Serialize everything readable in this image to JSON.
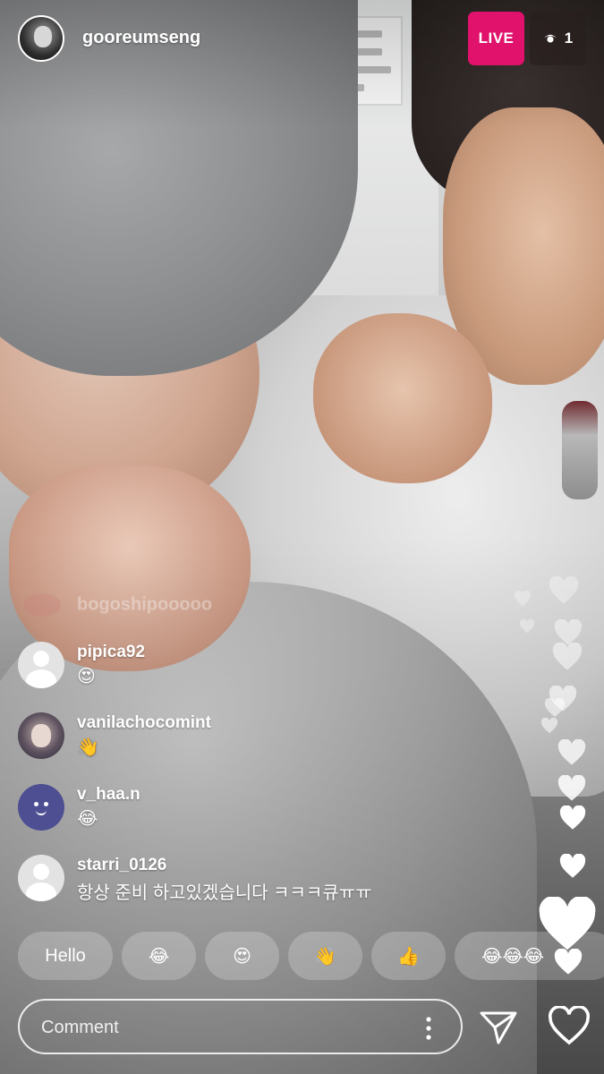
{
  "header": {
    "username": "gooreumseng",
    "live_label": "LIVE",
    "viewer_count": "1"
  },
  "comments": {
    "faded": {
      "username": "bogoshipooooo"
    },
    "items": [
      {
        "username": "pipica92",
        "text": "😍",
        "avatar": "default-avatar"
      },
      {
        "username": "vanilachocomint",
        "text": "👋",
        "avatar": "photo-avatar"
      },
      {
        "username": "v_haa.n",
        "text": "😂",
        "avatar": "purple-blob-avatar"
      },
      {
        "username": "starri_0126",
        "text": "항상 준비 하고있겠습니다 ㅋㅋㅋ큐ㅠㅠ",
        "avatar": "default-avatar"
      }
    ]
  },
  "quick_reactions": [
    "Hello",
    "😂",
    "😍",
    "👋",
    "👍",
    "😂😂😂"
  ],
  "composer": {
    "placeholder": "Comment",
    "icons": [
      "more-options-icon",
      "send-icon",
      "heart-icon"
    ]
  },
  "colors": {
    "live_badge": "#e0126b",
    "viewer_badge": "#281e1e",
    "text": "#ffffff"
  }
}
